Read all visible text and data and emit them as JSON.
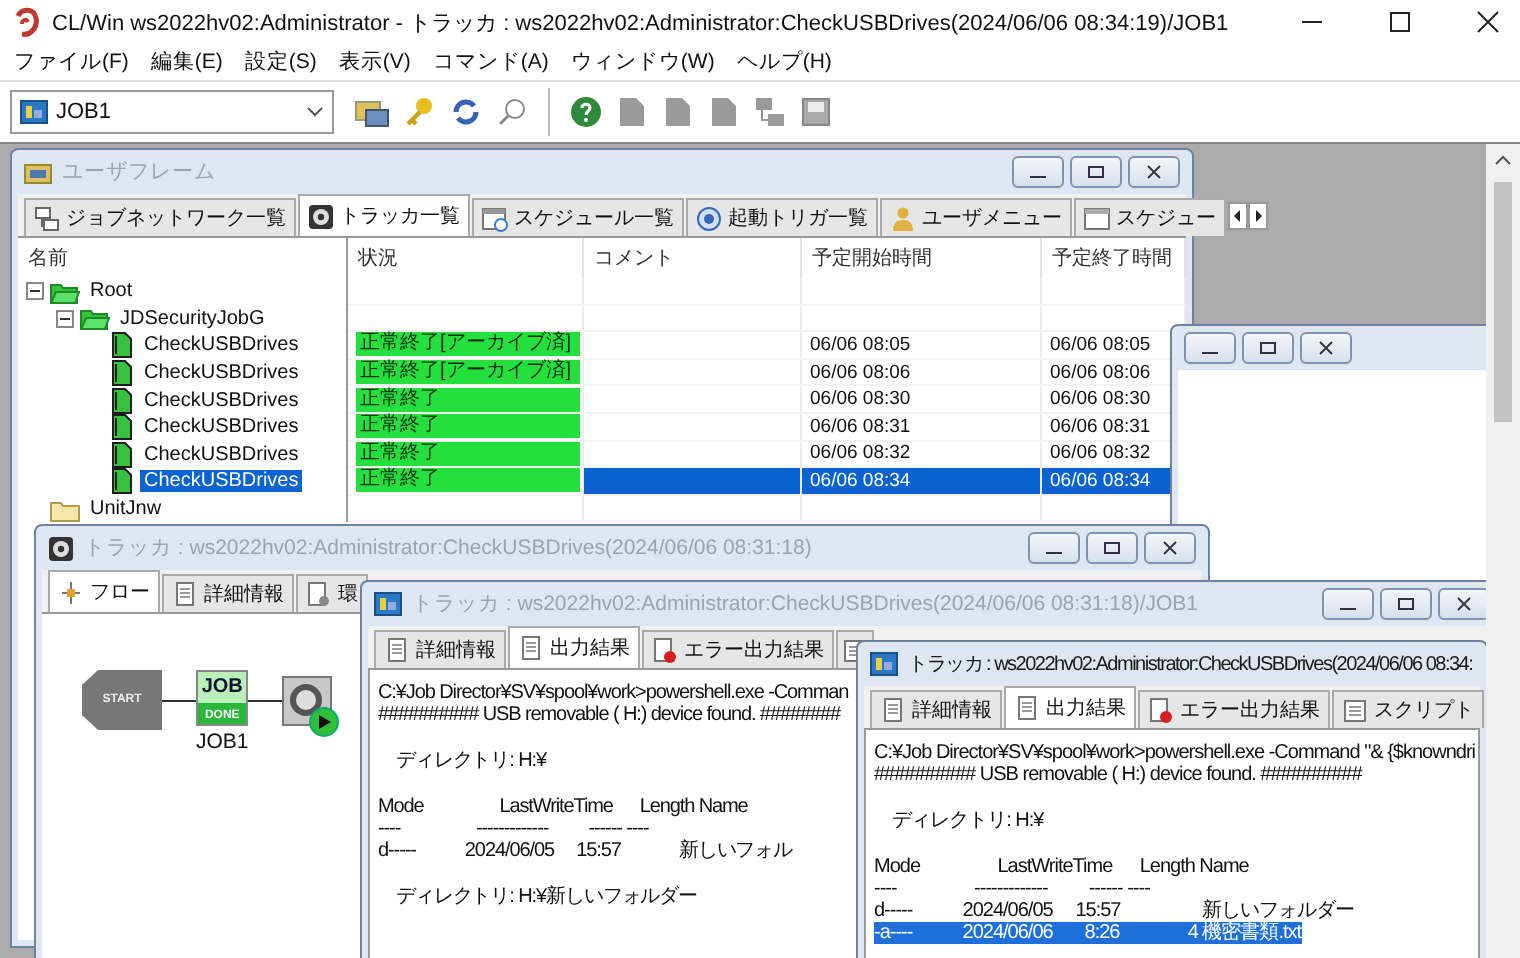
{
  "window": {
    "title": "CL/Win ws2022hv02:Administrator - トラッカ : ws2022hv02:Administrator:CheckUSBDrives(2024/06/06 08:34:19)/JOB1"
  },
  "menu": [
    "ファイル(F)",
    "編集(E)",
    "設定(S)",
    "表示(V)",
    "コマンド(A)",
    "ウィンドウ(W)",
    "ヘルプ(H)"
  ],
  "toolbar": {
    "job_selector": "JOB1"
  },
  "user_frame": {
    "title": "ユーザフレーム",
    "active": false,
    "tabs": [
      {
        "label": "ジョブネットワーク一覧",
        "selected": false
      },
      {
        "label": "トラッカ一覧",
        "selected": true
      },
      {
        "label": "スケジュール一覧",
        "selected": false
      },
      {
        "label": "起動トリガ一覧",
        "selected": false
      },
      {
        "label": "ユーザメニュー",
        "selected": false
      },
      {
        "label": "スケジュー",
        "selected": false
      }
    ],
    "tree_header": "名前",
    "columns": [
      "状況",
      "コメント",
      "予定開始時間",
      "予定終了時間"
    ],
    "tree": [
      {
        "name": "Root",
        "kind": "group",
        "expanded": true,
        "children": [
          {
            "name": "JDSecurityJobG",
            "kind": "group",
            "expanded": true,
            "children": [
              {
                "name": "CheckUSBDrives",
                "kind": "job",
                "selected": false,
                "status": "正常終了[アーカイブ済]",
                "start": "06/06 08:05",
                "end": "06/06 08:05"
              },
              {
                "name": "CheckUSBDrives",
                "kind": "job",
                "selected": false,
                "status": "正常終了[アーカイブ済]",
                "start": "06/06 08:06",
                "end": "06/06 08:06"
              },
              {
                "name": "CheckUSBDrives",
                "kind": "job",
                "selected": false,
                "status": "正常終了",
                "start": "06/06 08:30",
                "end": "06/06 08:30"
              },
              {
                "name": "CheckUSBDrives",
                "kind": "job",
                "selected": false,
                "status": "正常終了",
                "start": "06/06 08:31",
                "end": "06/06 08:31"
              },
              {
                "name": "CheckUSBDrives",
                "kind": "job",
                "selected": false,
                "status": "正常終了",
                "start": "06/06 08:32",
                "end": "06/06 08:32"
              },
              {
                "name": "CheckUSBDrives",
                "kind": "job",
                "selected": true,
                "status": "正常終了",
                "start": "06/06 08:34",
                "end": "06/06 08:34"
              }
            ]
          }
        ]
      },
      {
        "name": "UnitJnw",
        "kind": "unit"
      }
    ]
  },
  "flow_window": {
    "title": "トラッカ : ws2022hv02:Administrator:CheckUSBDrives(2024/06/06 08:31:18)",
    "active": false,
    "tabs": [
      {
        "label": "フロー",
        "selected": true
      },
      {
        "label": "詳細情報",
        "selected": false
      },
      {
        "label": "環",
        "selected": false
      }
    ],
    "nodes": [
      {
        "kind": "start",
        "label": "START"
      },
      {
        "kind": "job",
        "icon_text": "JOB",
        "state_text": "DONE",
        "caption": "JOB1"
      },
      {
        "kind": "monitor"
      }
    ]
  },
  "output_window": {
    "title": "トラッカ : ws2022hv02:Administrator:CheckUSBDrives(2024/06/06 08:31:18)/JOB1",
    "active": false,
    "tabs": [
      {
        "label": "詳細情報",
        "selected": false
      },
      {
        "label": "出力結果",
        "selected": true
      },
      {
        "label": "エラー出力結果",
        "selected": false
      }
    ],
    "blocks": [
      [
        {
          "text": "C:¥Job Director¥SV¥spool¥work>powershell.exe -Comman",
          "selected": false
        },
        {
          "text": "########## USB removable ( H:) device found. ########",
          "selected": false
        }
      ],
      [
        {
          "text": "    ディレクトリ: H:¥",
          "selected": false
        }
      ],
      [
        {
          "text": "Mode                 LastWriteTime      Length Name",
          "selected": false
        },
        {
          "text": "----                 -------------         ------ ----",
          "selected": false
        },
        {
          "text": "d-----           2024/06/05     15:57             新しいフォル",
          "selected": false
        }
      ],
      [
        {
          "text": "    ディレクトリ: H:¥新しいフォルダー",
          "selected": false
        }
      ]
    ]
  },
  "front_window": {
    "title": "トラッカ : ws2022hv02:Administrator:CheckUSBDrives(2024/06/06 08:34:",
    "active": true,
    "tabs": [
      {
        "label": "詳細情報",
        "selected": false
      },
      {
        "label": "出力結果",
        "selected": true
      },
      {
        "label": "エラー出力結果",
        "selected": false
      },
      {
        "label": "スクリプト",
        "selected": false
      }
    ],
    "blocks": [
      [
        {
          "text": "C:¥Job Director¥SV¥spool¥work>powershell.exe -Command \"& {$knowndri",
          "selected": false
        },
        {
          "text": "########## USB removable ( H:) device found. ##########",
          "selected": false
        }
      ],
      [
        {
          "text": "    ディレクトリ: H:¥",
          "selected": false
        }
      ],
      [
        {
          "text": "Mode                 LastWriteTime      Length Name",
          "selected": false
        },
        {
          "text": "----                 -------------         ------ ----",
          "selected": false
        },
        {
          "text": "d-----           2024/06/05     15:57                  新しいフォルダー",
          "selected": false
        },
        {
          "text": "-a----           2024/06/06       8:26               4 機密書類.txt",
          "selected": true
        }
      ]
    ]
  }
}
